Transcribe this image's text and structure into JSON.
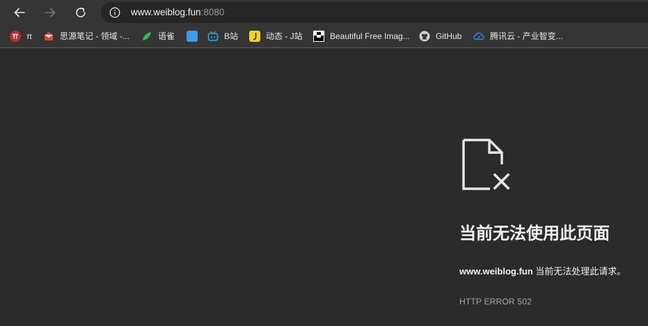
{
  "toolbar": {
    "back_icon": "arrow-left-icon",
    "forward_icon": "arrow-right-icon",
    "reload_icon": "reload-icon",
    "info_icon": "info-icon",
    "url_host": "www.weiblog.fun",
    "url_port": ":8080"
  },
  "bookmarks": [
    {
      "label": "π",
      "icon": "pi-icon",
      "color": "#d0312d"
    },
    {
      "label": "思源笔记 - 领域 -...",
      "icon": "siyuan-icon",
      "color": "#d84a3a"
    },
    {
      "label": "语雀",
      "icon": "yuque-icon",
      "color": "#2fbf5a"
    },
    {
      "label": "",
      "icon": "blue-square-icon",
      "color": "#3a9df0"
    },
    {
      "label": "B站",
      "icon": "bilibili-icon",
      "color": "#23ade5"
    },
    {
      "label": "动态 - J站",
      "icon": "jzhan-icon",
      "color": "#f4d21f"
    },
    {
      "label": "Beautiful Free Imag...",
      "icon": "unsplash-icon",
      "color": "#000000"
    },
    {
      "label": "GitHub",
      "icon": "github-icon",
      "color": "#cccccc"
    },
    {
      "label": "腾讯云 - 产业智变...",
      "icon": "tencent-cloud-icon",
      "color": "#1a8cff"
    }
  ],
  "error": {
    "icon": "broken-file-icon",
    "title": "当前无法使用此页面",
    "desc_host": "www.weiblog.fun",
    "desc_text": " 当前无法处理此请求。",
    "code": "HTTP ERROR 502"
  }
}
